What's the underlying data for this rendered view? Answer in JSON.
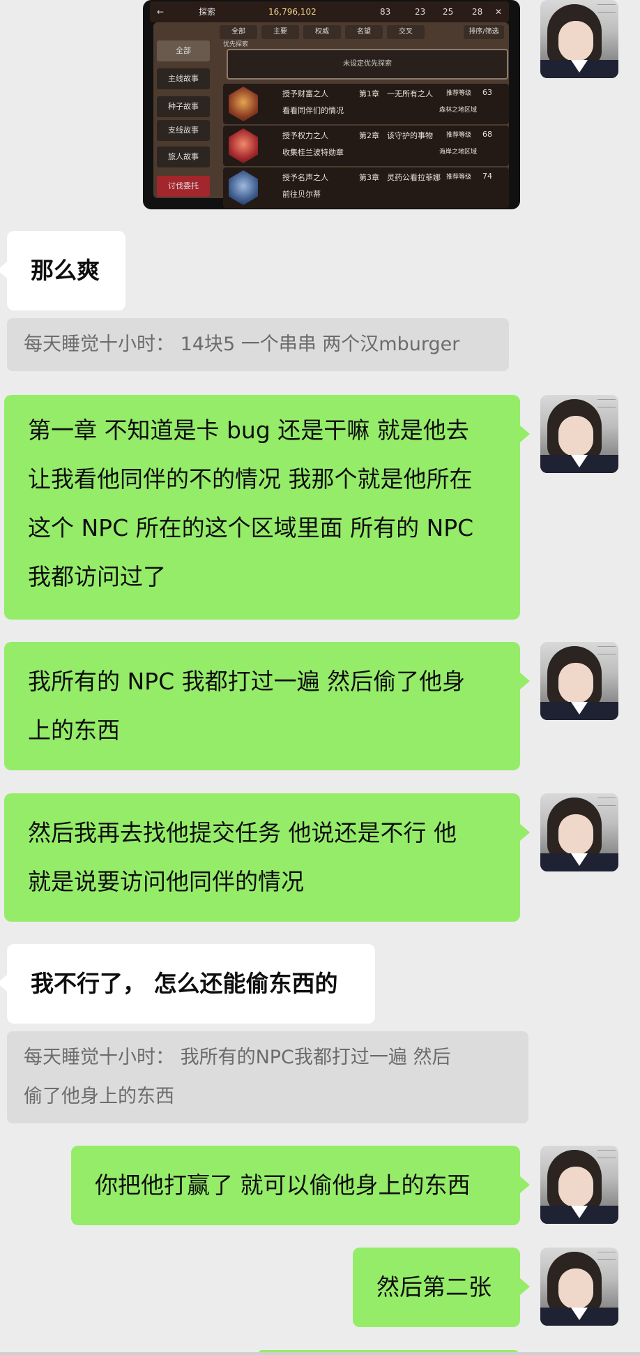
{
  "game_screenshot": {
    "back_label": "←",
    "title": "探索",
    "gold": "16,796,102",
    "counter_1": "83",
    "counter_2": "23",
    "counter_3": "25",
    "counter_4": "28",
    "close_label": "✕",
    "sort_label": "排序/筛选",
    "tabs": [
      "全部",
      "主要",
      "权威",
      "名望",
      "交叉"
    ],
    "side_items": [
      "全部",
      "主线故事",
      "种子故事",
      "支线故事",
      "旅人故事"
    ],
    "main_side_button": "讨伐委托",
    "priority_label": "优先探索",
    "priority_empty": "未设定优先探索",
    "quests": [
      {
        "name": "授予财富之人",
        "chapter": "第1章",
        "chapter_title": "一无所有之人",
        "task": "看看同伴们的情况",
        "level_label": "推荐等级",
        "level": "63",
        "area": "森林之地区域"
      },
      {
        "name": "授予权力之人",
        "chapter": "第2章",
        "chapter_title": "该守护的事物",
        "task": "收集桂兰波特勋章",
        "level_label": "推荐等级",
        "level": "68",
        "area": "海岸之地区域"
      },
      {
        "name": "授予名声之人",
        "chapter": "第3章",
        "chapter_title": "灵药公看拉菲娜",
        "task": "前往贝尔蒂",
        "level_label": "推荐等级",
        "level": "74",
        "area": ""
      }
    ]
  },
  "messages": {
    "m1": "那么爽",
    "q1": "每天睡觉十小时： 14块5  一个串串  两个汉mburger",
    "m2_lines": [
      "第一章  不知道是卡 bug 还是干嘛  就是他去",
      "让我看他同伴的不的情况  我那个就是他所在",
      "这个 NPC 所在的这个区域里面  所有的 NPC",
      "我都访问过了"
    ],
    "m3_lines": [
      "我所有的 NPC 我都打过一遍  然后偷了他身",
      "上的东西"
    ],
    "m4_lines": [
      "然后我再去找他提交任务  他说还是不行  他",
      "就是说要访问他同伴的情况"
    ],
    "m5": "我不行了， 怎么还能偷东西的",
    "q2_lines": [
      "每天睡觉十小时： 我所有的NPC我都打过一遍  然后",
      "偷了他身上的东西"
    ],
    "m6": "你把他打赢了  就可以偷他身上的东西",
    "m7": "然后第二张"
  },
  "colors": {
    "sent_bubble": "#95ec69",
    "received_bubble": "#ffffff",
    "background": "#ececec",
    "quote": "#dcdcdc"
  }
}
